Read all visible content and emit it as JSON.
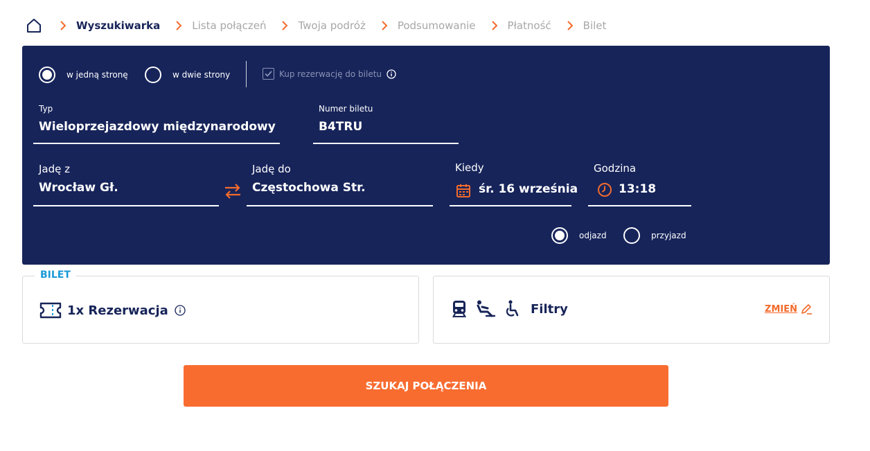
{
  "breadcrumb": {
    "items": [
      {
        "label": "Wyszukiwarka",
        "active": true
      },
      {
        "label": "Lista połączeń",
        "active": false
      },
      {
        "label": "Twoja podróż",
        "active": false
      },
      {
        "label": "Podsumowanie",
        "active": false
      },
      {
        "label": "Płatność",
        "active": false
      },
      {
        "label": "Bilet",
        "active": false
      }
    ],
    "home_icon": "home-icon",
    "separator_icon": "chevron-right-icon"
  },
  "trip_type": {
    "one_way": {
      "label": "w jedną stronę",
      "checked": true
    },
    "round_trip": {
      "label": "w dwie strony",
      "checked": false
    }
  },
  "reservation_checkbox": {
    "label": "Kup rezerwację do biletu",
    "checked": true,
    "disabled": true
  },
  "form": {
    "type": {
      "label": "Typ",
      "value": "Wieloprzejazdowy międzynarodowy"
    },
    "ticket_number": {
      "label": "Numer biletu",
      "value": "B4TRU"
    },
    "from": {
      "label": "Jadę z",
      "value": "Wrocław Gł."
    },
    "to": {
      "label": "Jadę do",
      "value": "Częstochowa Str."
    },
    "date": {
      "label": "Kiedy",
      "value": "śr. 16 września"
    },
    "time": {
      "label": "Godzina",
      "value": "13:18"
    }
  },
  "time_mode": {
    "departure": {
      "label": "odjazd",
      "checked": true
    },
    "arrival": {
      "label": "przyjazd",
      "checked": false
    }
  },
  "ticket_card": {
    "legend": "BILET",
    "text": "1x Rezerwacja"
  },
  "filters_card": {
    "text": "Filtry",
    "change_label": "ZMIEŃ",
    "icons": [
      "train-icon",
      "seat-icon",
      "wheelchair-icon"
    ]
  },
  "search_button": {
    "label": "SZUKAJ POŁĄCZENIA"
  },
  "colors": {
    "navy": "#17245a",
    "orange": "#f86c30",
    "blue": "#1b9ad6",
    "muted": "#a7a7a7"
  }
}
